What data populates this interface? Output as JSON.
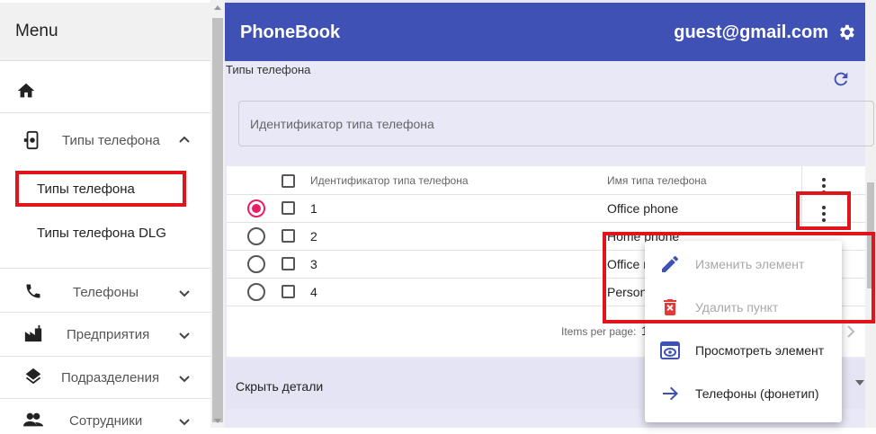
{
  "sidebar": {
    "menu_title": "Menu",
    "items": [
      {
        "label": "Типы телефона"
      },
      {
        "label": "Типы телефона"
      },
      {
        "label": "Типы телефона DLG"
      },
      {
        "label": "Телефоны"
      },
      {
        "label": "Предприятия"
      },
      {
        "label": "Подразделения"
      },
      {
        "label": "Сотрудники"
      }
    ]
  },
  "appbar": {
    "title": "PhoneBook",
    "user_email": "guest@gmail.com"
  },
  "page": {
    "section_title": "Типы телефона",
    "filter_placeholder": "Идентификатор типа телефона"
  },
  "table": {
    "columns": [
      "Идентификатор типа телефона",
      "Имя типа телефона"
    ],
    "rows": [
      {
        "id": "1",
        "name": "Office phone",
        "selected": true
      },
      {
        "id": "2",
        "name": "Home phone",
        "selected": false
      },
      {
        "id": "3",
        "name": "Office m",
        "selected": false
      },
      {
        "id": "4",
        "name": "Person",
        "selected": false
      }
    ],
    "paginator_label": "Items per page:",
    "paginator_value": "1"
  },
  "details": {
    "label": "Скрыть детали"
  },
  "context_menu": {
    "items": [
      {
        "label": "Изменить элемент",
        "icon": "pencil-icon",
        "disabled": true
      },
      {
        "label": "Удалить пункт",
        "icon": "delete-icon",
        "disabled": true
      },
      {
        "label": "Просмотреть элемент",
        "icon": "eye-icon",
        "disabled": false
      },
      {
        "label": "Телефоны (фонетип)",
        "icon": "arrow-right-icon",
        "disabled": false
      }
    ]
  },
  "colors": {
    "primary": "#3f51b5",
    "accent": "#e91e63",
    "highlight": "#e0151b",
    "danger": "#e53935"
  }
}
